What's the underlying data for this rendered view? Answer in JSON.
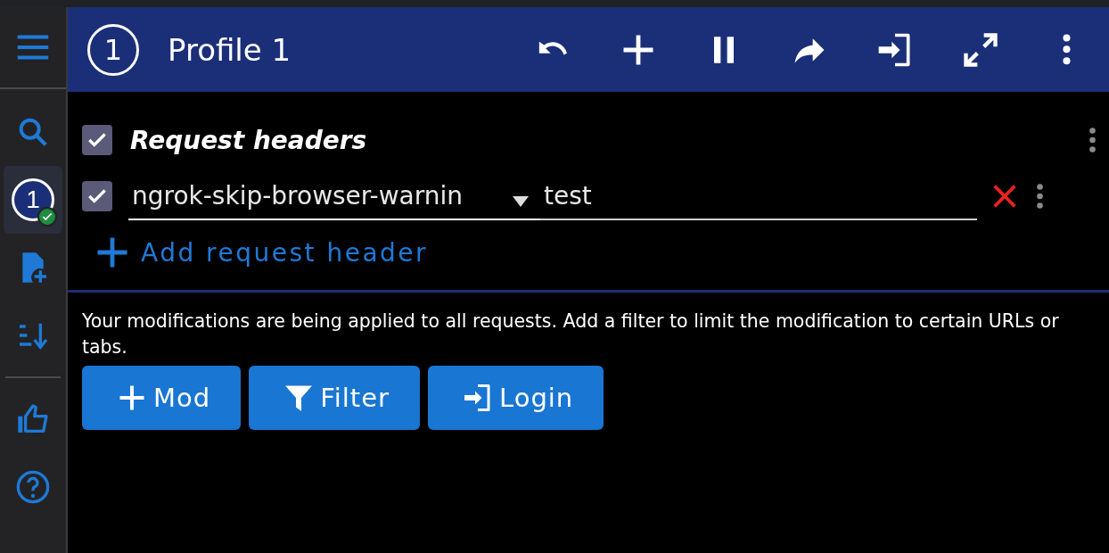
{
  "sidebar": {
    "items": [
      {
        "kind": "search",
        "selected": false
      },
      {
        "kind": "profile",
        "label": "1",
        "selected": true,
        "active": true
      },
      {
        "kind": "add-file",
        "selected": false
      },
      {
        "kind": "sort",
        "selected": false
      },
      {
        "kind": "divider"
      },
      {
        "kind": "like",
        "selected": false
      },
      {
        "kind": "help",
        "selected": false
      }
    ]
  },
  "header": {
    "badge": "1",
    "title": "Profile 1",
    "actions": [
      {
        "kind": "undo"
      },
      {
        "kind": "add"
      },
      {
        "kind": "pause"
      },
      {
        "kind": "share"
      },
      {
        "kind": "login"
      },
      {
        "kind": "expand"
      },
      {
        "kind": "more"
      }
    ]
  },
  "section": {
    "title": "Request headers",
    "checked": true,
    "rows": [
      {
        "checked": true,
        "name": "ngrok-skip-browser-warnin",
        "value": "test"
      }
    ],
    "add_label": "Add request header"
  },
  "notice": "Your modifications are being applied to all requests. Add a filter to limit the modification to certain URLs or tabs.",
  "buttons": [
    {
      "kind": "mod",
      "label": "Mod"
    },
    {
      "kind": "filter",
      "label": "Filter"
    },
    {
      "kind": "login",
      "label": "Login"
    }
  ]
}
